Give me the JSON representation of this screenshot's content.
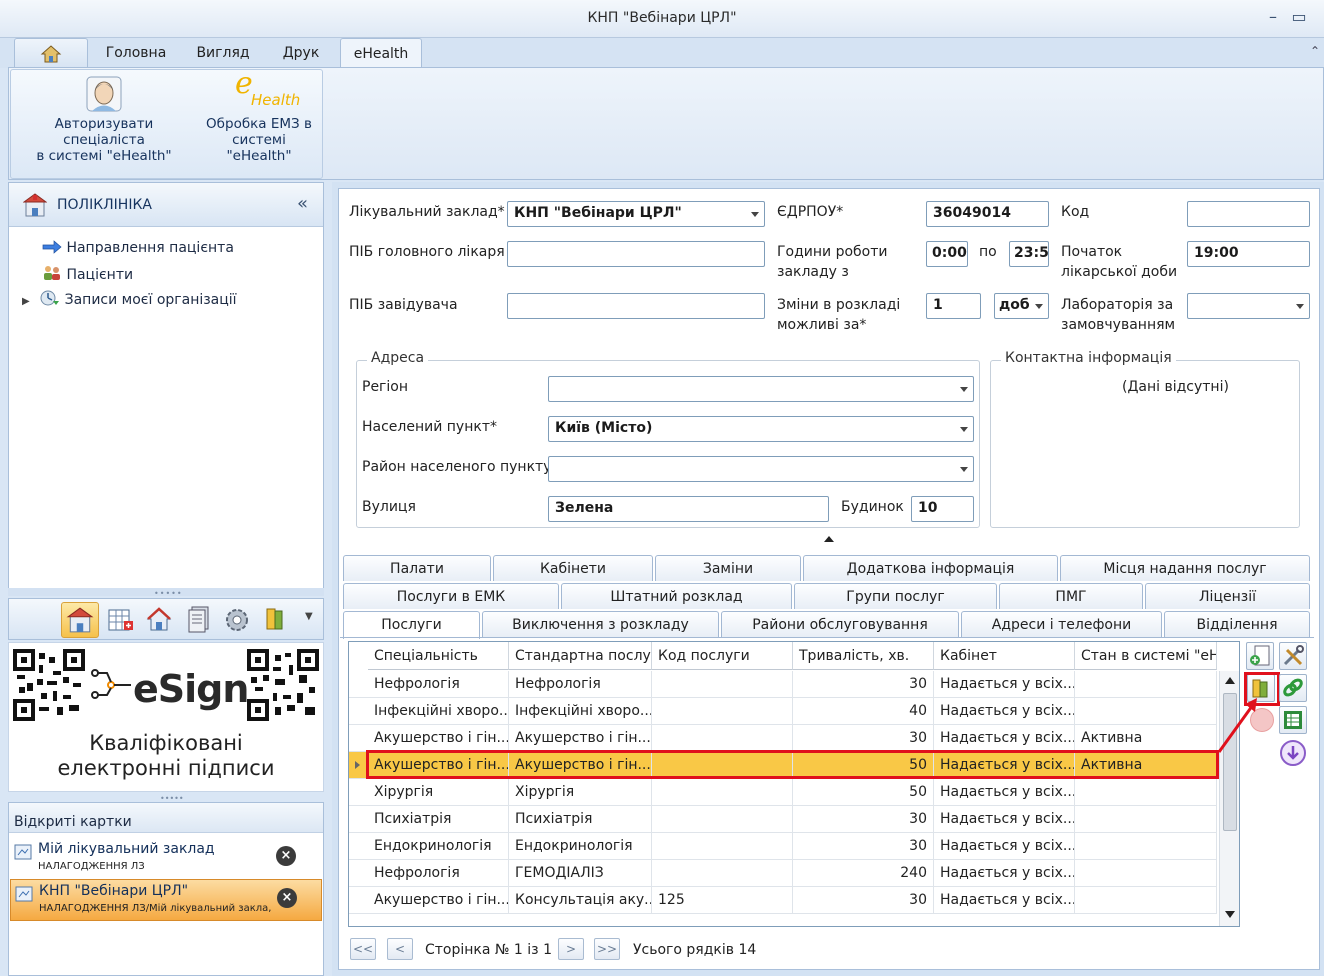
{
  "window": {
    "title": "КНП \"Вебінари ЦРЛ\""
  },
  "ribbon": {
    "tabs": [
      "Головна",
      "Вигляд",
      "Друк",
      "eHealth"
    ],
    "active_tab": "eHealth",
    "buttons": [
      {
        "label_line1": "Авторизувати спеціаліста",
        "label_line2": "в системі \"eHealth\"",
        "icon": "doctor-icon"
      },
      {
        "label_line1": "Обробка ЕМЗ в",
        "label_line2": "системі \"eHealth\"",
        "icon": "ehealth-logo-icon",
        "logo_text": "Health"
      }
    ]
  },
  "nav": {
    "title": "ПОЛІКЛІНІКА",
    "items": [
      "Направлення пацієнта",
      "Пацієнти",
      "Записи моєї організації"
    ]
  },
  "esign": {
    "brand": "eSign",
    "caption_line1": "Кваліфіковані",
    "caption_line2": "електронні підписи"
  },
  "open_cards": {
    "title": "Відкриті картки",
    "items": [
      {
        "title": "Мій лікувальний заклад",
        "subtitle": "НАЛАГОДЖЕННЯ ЛЗ",
        "active": false
      },
      {
        "title": "КНП \"Вебінари ЦРЛ\"",
        "subtitle": "НАЛАГОДЖЕННЯ ЛЗ/Мій лікувальний закла,",
        "active": true
      }
    ]
  },
  "form": {
    "facility_label": "Лікувальний заклад*",
    "facility_value": "КНП \"Вебінари ЦРЛ\"",
    "edrpou_label": "ЄДРПОУ*",
    "edrpou_value": "36049014",
    "code_label": "Код",
    "code_value": "",
    "chief_label": "ПІБ головного лікаря",
    "chief_value": "",
    "hours_label_line1": "Години роботи",
    "hours_label_line2": "закладу з",
    "hours_from": "0:00",
    "hours_to_label": "по",
    "hours_to": "23:5",
    "day_start_label_line1": "Початок",
    "day_start_label_line2": "лікарської доби",
    "day_start_value": "19:00",
    "head_label": "ПІБ завідувача",
    "head_value": "",
    "changes_label_line1": "Зміни в розкладі",
    "changes_label_line2": "можливі за*",
    "changes_value": "1",
    "changes_unit": "доб",
    "lab_label_line1": "Лабораторія за",
    "lab_label_line2": "замовчуванням",
    "lab_value": ""
  },
  "address": {
    "title": "Адреса",
    "region_label": "Регіон",
    "region_value": "",
    "city_label": "Населений пункт*",
    "city_value": "Київ (Місто)",
    "district_label": "Район населеного пункту",
    "district_value": "",
    "street_label": "Вулиця",
    "street_value": "Зелена",
    "house_label": "Будинок",
    "house_value": "10"
  },
  "contact": {
    "title": "Контактна інформація",
    "empty_text": "(Дані відсутні)"
  },
  "tabs": {
    "row1": [
      "Палати",
      "Кабінети",
      "Заміни",
      "Додаткова інформація",
      "Місця надання послуг"
    ],
    "row2": [
      "Послуги в ЕМК",
      "Штатний розклад",
      "Групи послуг",
      "ПМГ",
      "Ліцензії"
    ],
    "row3": [
      "Послуги",
      "Виключення з розкладу",
      "Райони обслуговування",
      "Адреси і телефони",
      "Відділення"
    ],
    "active": "Послуги"
  },
  "grid": {
    "columns": [
      "Спеціальність",
      "Стандартна послуга",
      "Код послуги",
      "Тривалість, хв.",
      "Кабінет",
      "Стан в системі \"eHealth\""
    ],
    "rows": [
      [
        "Нефрологія",
        "Нефрологія",
        "",
        "30",
        "Надається у всіх...",
        ""
      ],
      [
        "Інфекційні хворо...",
        "Інфекційні хворо...",
        "",
        "40",
        "Надається у всіх...",
        ""
      ],
      [
        "Акушерство і гін...",
        "Акушерство і гін...",
        "",
        "30",
        "Надається у всіх...",
        "Активна"
      ],
      [
        "Акушерство і гін...",
        "Акушерство і гін...",
        "",
        "50",
        "Надається у всіх...",
        "Активна"
      ],
      [
        "Хірургія",
        "Хірургія",
        "",
        "50",
        "Надається у всіх...",
        ""
      ],
      [
        "Психіатрія",
        "Психіатрія",
        "",
        "30",
        "Надається у всіх...",
        ""
      ],
      [
        "Ендокринологія",
        "Ендокринологія",
        "",
        "30",
        "Надається у всіх...",
        ""
      ],
      [
        "Нефрологія",
        "ГЕМОДІАЛІЗ",
        "",
        "240",
        "Надається у всіх...",
        ""
      ],
      [
        "Акушерство і гін...",
        "Консультація аку...",
        "125",
        "30",
        "Надається у всіх...",
        ""
      ]
    ],
    "selected_row": 3
  },
  "pager": {
    "page_text": "Сторінка № 1 із 1",
    "total_text": "Усього рядків 14",
    "first": "<<",
    "prev": "<",
    "next": ">",
    "last": ">>"
  },
  "colors": {
    "accent": "#f9c846",
    "highlight": "#e0101c",
    "panel_bg": "#d9e6f5"
  }
}
